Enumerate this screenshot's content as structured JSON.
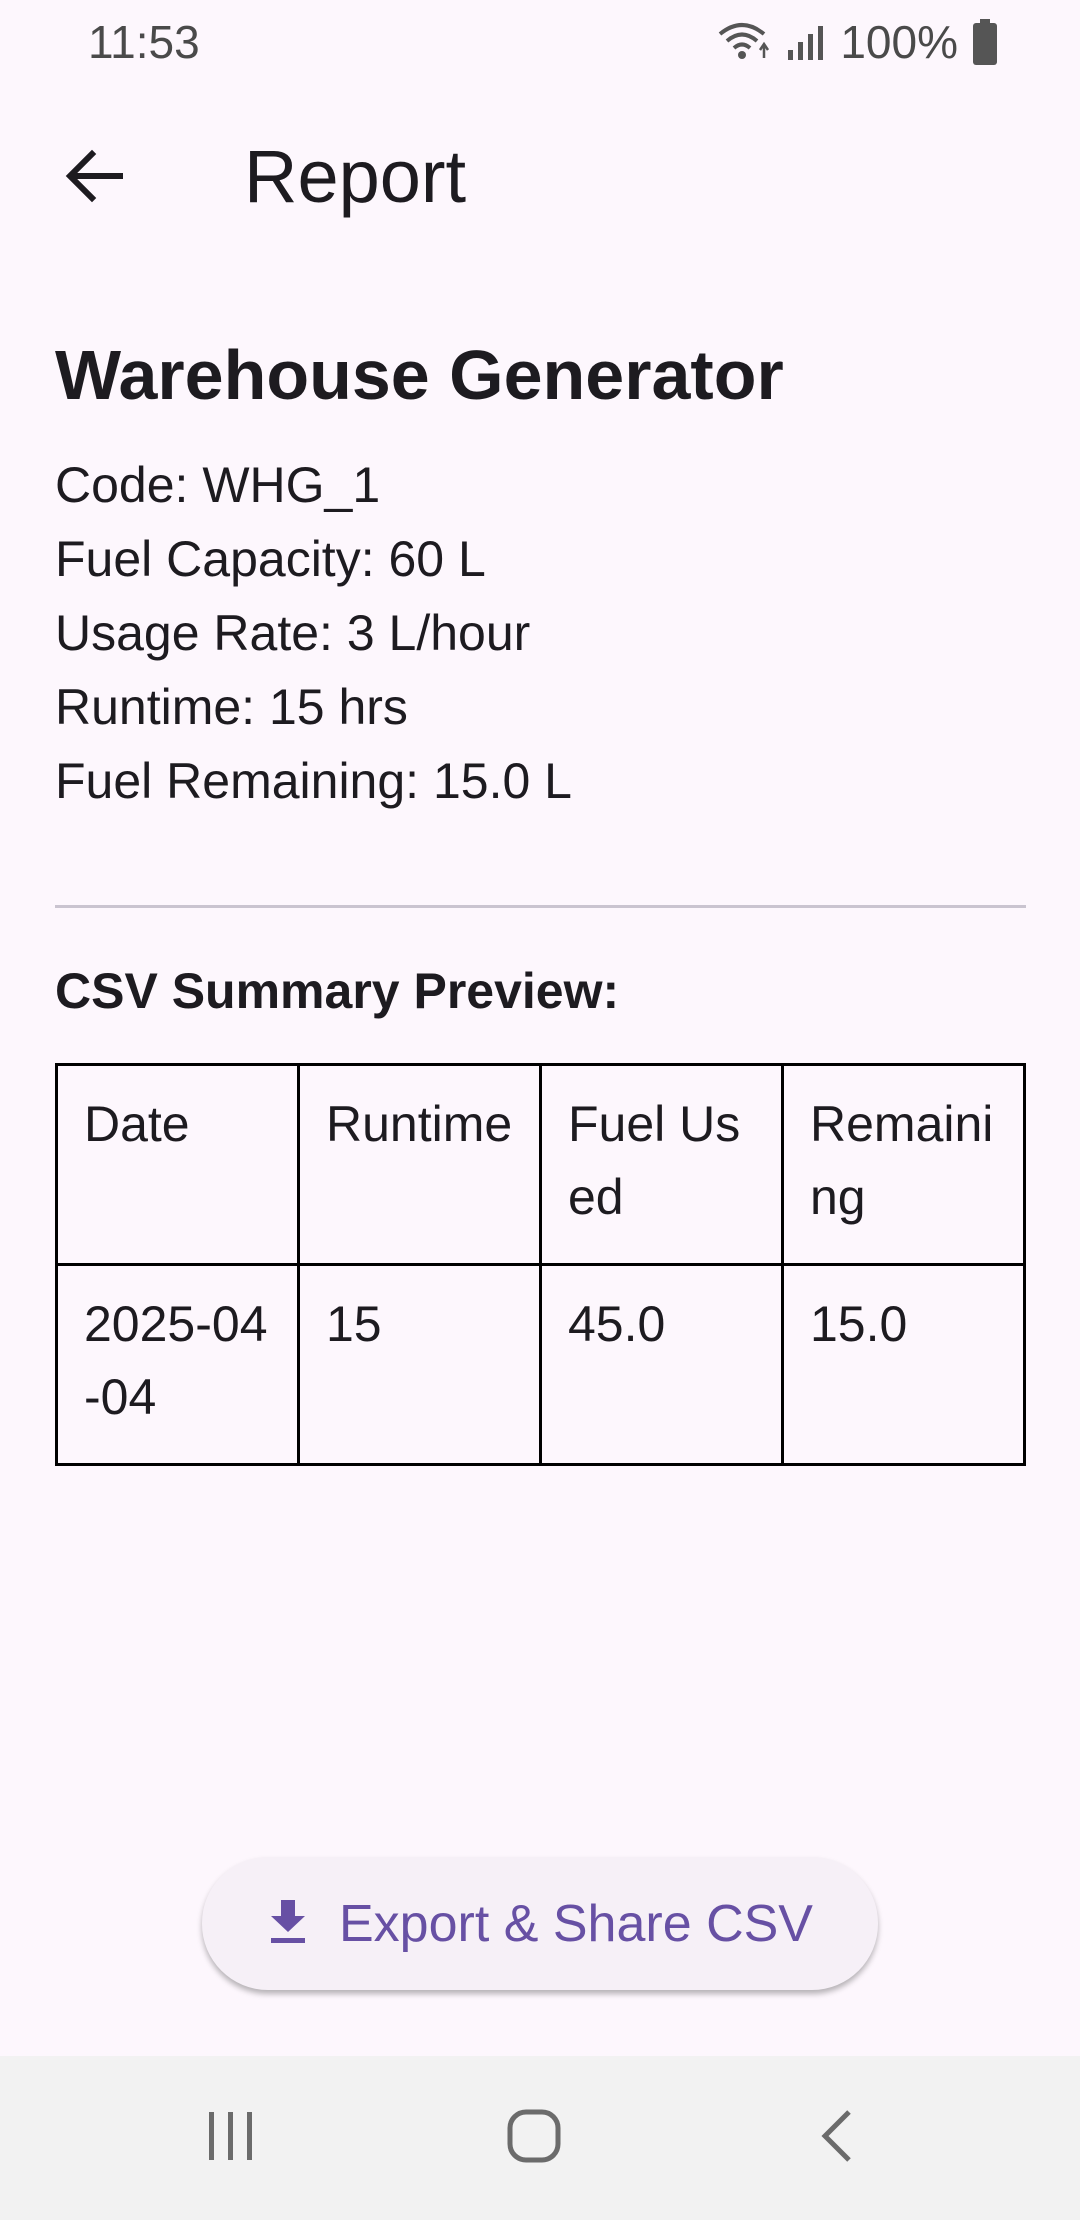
{
  "status_bar": {
    "time": "11:53",
    "battery": "100%"
  },
  "app_bar": {
    "title": "Report"
  },
  "device": {
    "name": "Warehouse Generator",
    "details": [
      "Code: WHG_1",
      "Fuel Capacity: 60 L",
      "Usage Rate: 3 L/hour",
      "Runtime: 15 hrs",
      "Fuel Remaining: 15.0 L"
    ]
  },
  "csv_preview": {
    "title": "CSV Summary Preview:",
    "headers": [
      "Date",
      "Runtime",
      "Fuel Used",
      "Remaining"
    ],
    "rows": [
      [
        "2025-04-04",
        "15",
        "45.0",
        "15.0"
      ]
    ]
  },
  "export_button": {
    "label": "Export & Share CSV",
    "icon": "download-icon"
  },
  "colors": {
    "background": "#fdf7fd",
    "accent": "#6750a4",
    "text": "#1d1b20"
  }
}
